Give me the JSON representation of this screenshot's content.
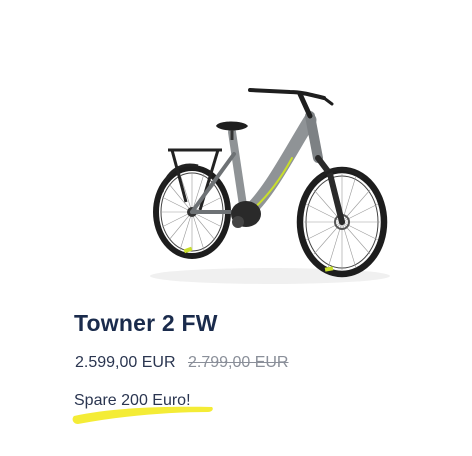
{
  "product": {
    "title": "Towner 2 FW",
    "price_current": "2.599,00 EUR",
    "price_old": "2.799,00 EUR",
    "savings_text": "Spare 200 Euro!",
    "image_icon": "e-bike-image"
  },
  "colors": {
    "title": "#1a2b4c",
    "text": "#2a3550",
    "strikethrough": "#8a8f99",
    "highlight": "#f4ec36",
    "bike_frame": "#8f9396",
    "bike_accent": "#c9df2b"
  }
}
